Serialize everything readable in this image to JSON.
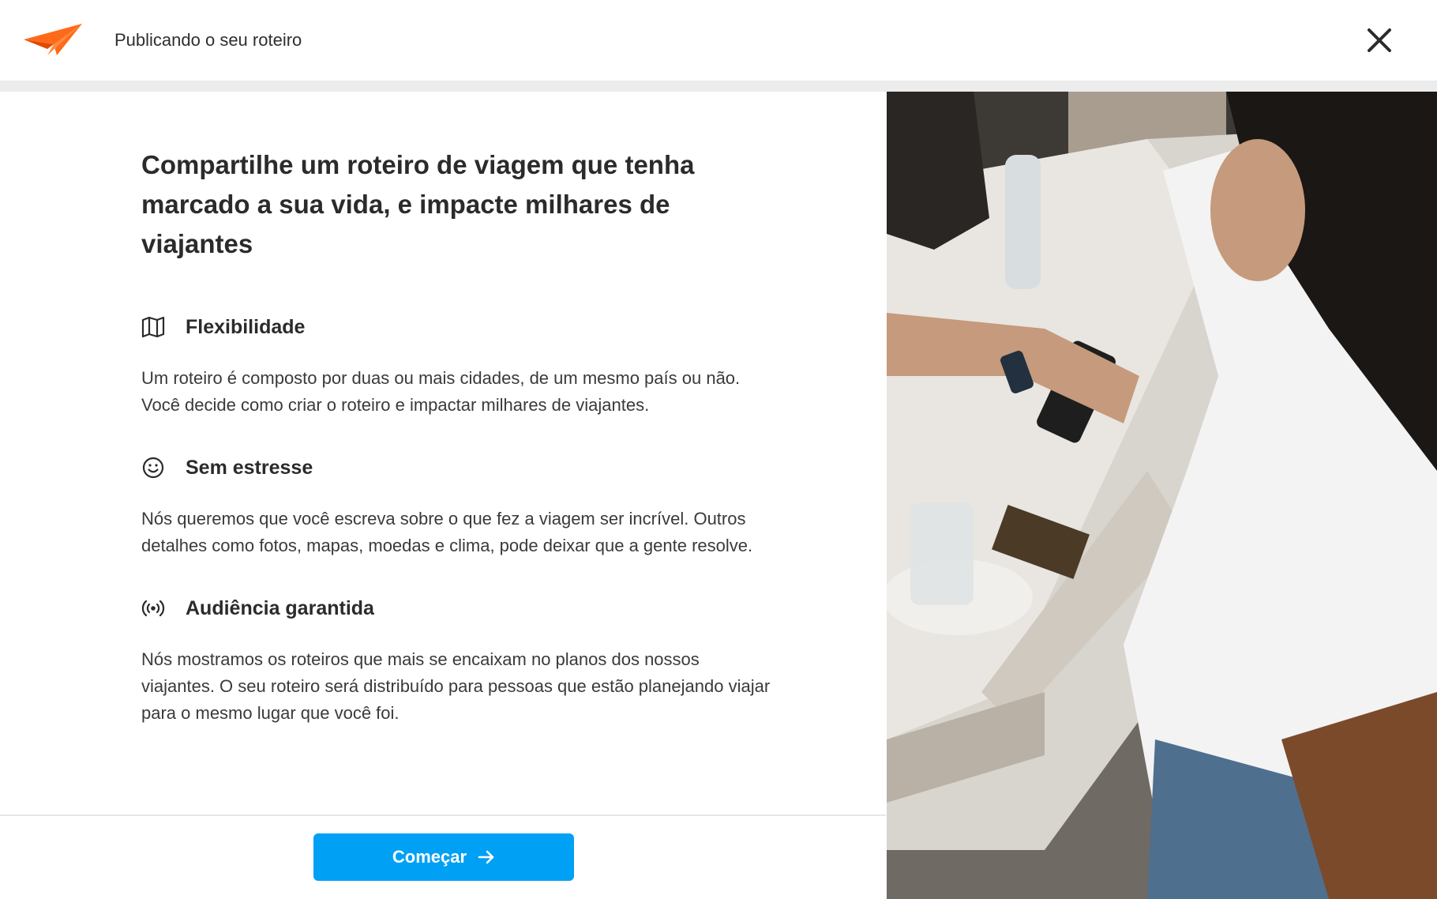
{
  "header": {
    "title": "Publicando o seu roteiro",
    "brand_color": "#ff6a1a",
    "close_icon": "close-icon"
  },
  "main": {
    "headline": "Compartilhe um roteiro de viagem que tenha marcado a sua vida, e impacte milhares de viajantes",
    "features": [
      {
        "icon": "map-icon",
        "title": "Flexibilidade",
        "text": "Um roteiro é composto por duas ou mais cidades, de um mesmo país ou não. Você decide como criar o roteiro e impactar milhares de viajantes."
      },
      {
        "icon": "smile-icon",
        "title": "Sem estresse",
        "text": "Nós queremos que você escreva sobre o que fez a viagem ser incrível. Outros detalhes como fotos, mapas, moedas e clima, pode deixar que a gente resolve."
      },
      {
        "icon": "broadcast-icon",
        "title": "Audiência garantida",
        "text": "Nós mostramos os roteiros que mais se encaixam no planos dos nossos viajantes. O seu roteiro será distribuído para pessoas que estão planejando viajar para o mesmo lugar que você foi."
      }
    ]
  },
  "footer": {
    "start_label": "Começar",
    "button_color": "#00a0f5"
  }
}
